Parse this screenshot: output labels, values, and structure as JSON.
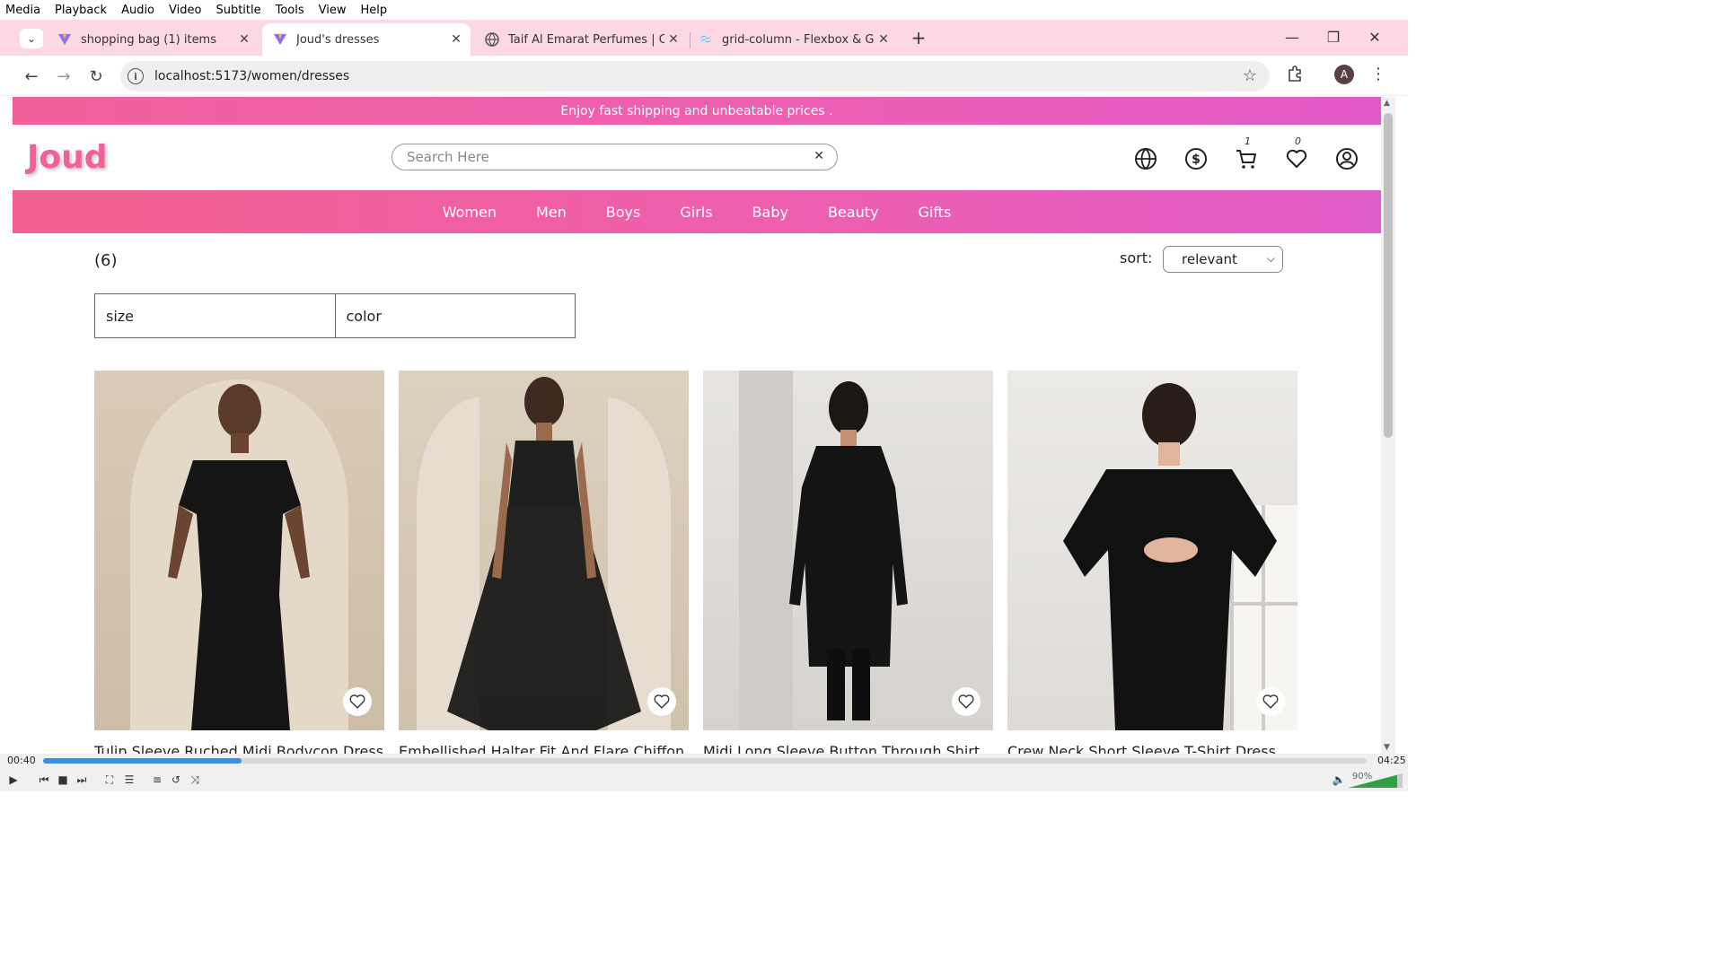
{
  "vlc": {
    "menu": [
      "Media",
      "Playback",
      "Audio",
      "Video",
      "Subtitle",
      "Tools",
      "View",
      "Help"
    ],
    "time_elapsed": "00:40",
    "time_total": "04:25",
    "progress": 0.15,
    "volume": "90%"
  },
  "browser": {
    "tabs": [
      {
        "label": "shopping bag (1) items"
      },
      {
        "label": "Joud's dresses"
      },
      {
        "label": "Taif Al Emarat Perfumes | Contin"
      },
      {
        "label": "grid-column - Flexbox & Grid -"
      }
    ],
    "url": "localhost:5173/women/dresses",
    "profile_initial": "A"
  },
  "site": {
    "promo": "Enjoy fast shipping and unbeatable prices .",
    "logo": "Joud",
    "search_placeholder": "Search Here",
    "cart_count": "1",
    "wishlist_count": "0",
    "nav": [
      "Women",
      "Men",
      "Boys",
      "Girls",
      "Baby",
      "Beauty",
      "Gifts"
    ],
    "result_count": "(6)",
    "sort_label": "sort:",
    "sort_value": "relevant",
    "filters": [
      "size",
      "color"
    ],
    "products": [
      {
        "title": "Tulip Sleeve Ruched Midi Bodycon Dress"
      },
      {
        "title": "Embellished Halter Fit And Flare Chiffon"
      },
      {
        "title": "Midi Long Sleeve Button Through Shirt"
      },
      {
        "title": "Crew Neck Short Sleeve T-Shirt Dress"
      }
    ]
  }
}
